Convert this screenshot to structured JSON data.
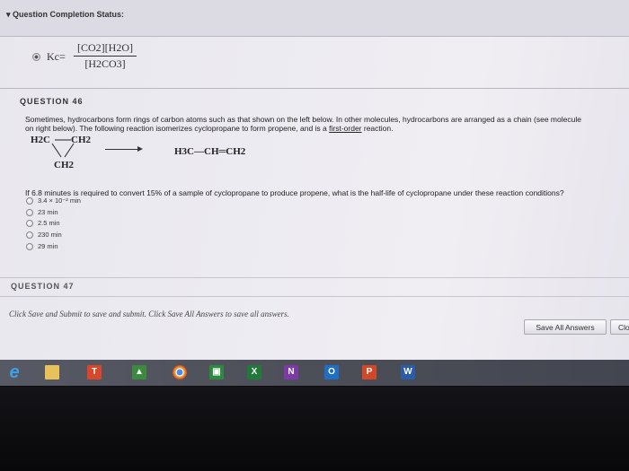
{
  "status_bar": {
    "label": "Question Completion Status:"
  },
  "prev_answer": {
    "lhs": "Kc=",
    "numerator": "[CO2][H2O]",
    "denominator": "[H2CO3]"
  },
  "question46": {
    "title": "QUESTION 46",
    "text_line1": "Sometimes, hydrocarbons form rings of carbon atoms such as that shown on the left below. In other molecules, hydrocarbons are arranged as a chain (see molecule",
    "text_line2_before": "on right below). The following reaction isomerizes cyclopropane to form propene, and is a ",
    "text_line2_link": "first-order",
    "text_line2_after": " reaction.",
    "cyclo_top_left": "H2C",
    "cyclo_top_right": "CH2",
    "cyclo_bottom": "CH2",
    "product": "H3C—CH═CH2",
    "prompt": "If 6.8 minutes is required to convert 15% of a sample of cyclopropane to produce propene, what is the half-life of cyclopropane under these reaction conditions?",
    "options": [
      "3.4 × 10⁻² min",
      "23 min",
      "2.5 min",
      "230 min",
      "29 min"
    ]
  },
  "question47": {
    "title": "QUESTION 47"
  },
  "instructions": "Click Save and Submit to save and submit. Click Save All Answers to save all answers.",
  "buttons": {
    "save_all": "Save All Answers",
    "close": "Clo"
  },
  "taskbar": {
    "icons": [
      {
        "name": "ie-icon",
        "glyph": "e",
        "color": "#3ea0e8"
      },
      {
        "name": "file-explorer-icon",
        "glyph": "",
        "color": "#e8c15a"
      },
      {
        "name": "t-app-icon",
        "glyph": "T",
        "color": "#d9472b"
      },
      {
        "name": "google-drive-icon",
        "glyph": "▲",
        "color": "#3b8a3e"
      },
      {
        "name": "chrome-icon",
        "glyph": "",
        "color": "#e6b82e"
      },
      {
        "name": "store-icon",
        "glyph": "▣",
        "color": "#2b8a3e"
      },
      {
        "name": "excel-icon",
        "glyph": "X",
        "color": "#1f7a3a"
      },
      {
        "name": "onenote-icon",
        "glyph": "N",
        "color": "#7b3aa8"
      },
      {
        "name": "outlook-icon",
        "glyph": "O",
        "color": "#1e6fc4"
      },
      {
        "name": "powerpoint-icon",
        "glyph": "P",
        "color": "#d24726"
      },
      {
        "name": "word-icon",
        "glyph": "W",
        "color": "#2b5ca8"
      }
    ]
  }
}
